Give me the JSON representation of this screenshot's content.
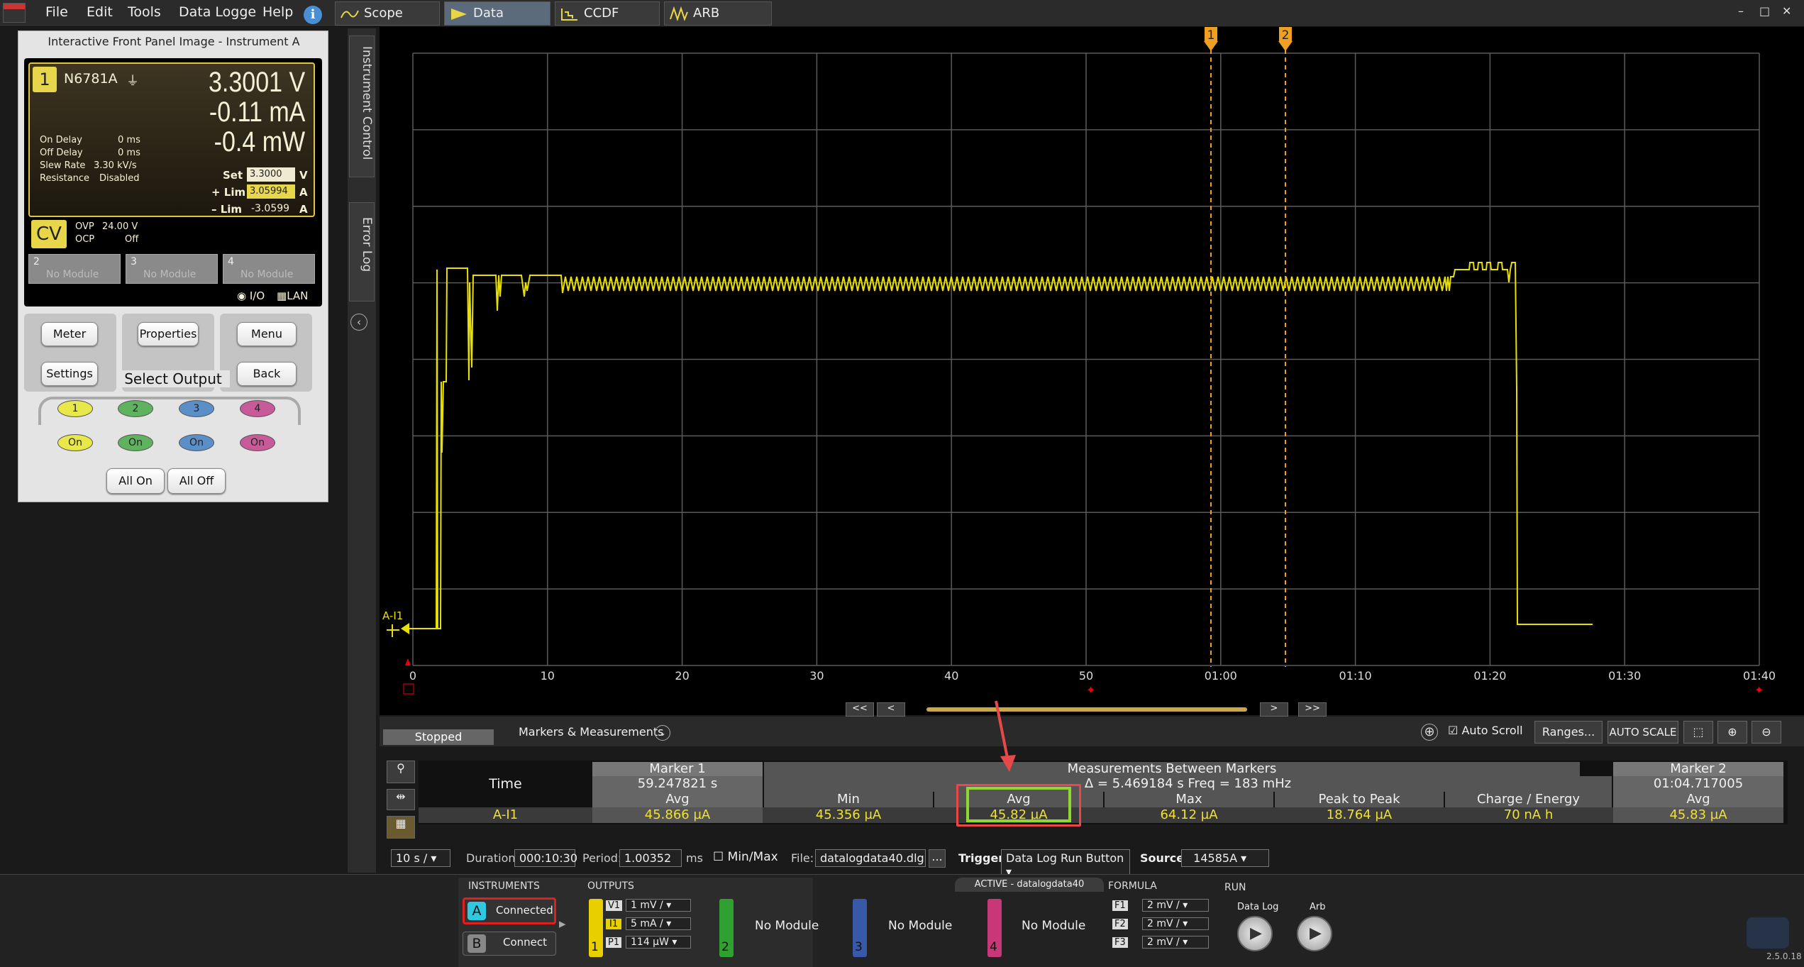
{
  "menubar": {
    "items": [
      "File",
      "Edit",
      "Tools",
      "Data Logge",
      "Help"
    ],
    "tabs": [
      "Scope",
      "Data Logger",
      "CCDF",
      "ARB"
    ],
    "window_controls": [
      "–",
      "□",
      "✕"
    ]
  },
  "front_panel": {
    "title": "Interactive Front Panel Image - Instrument A",
    "channel": "1",
    "model": "N6781A",
    "voltage": "3.3001 V",
    "current": "-0.11 mA",
    "power": "-0.4 mW",
    "on_delay_label": "On Delay",
    "on_delay_value": "0 ms",
    "off_delay_label": "Off Delay",
    "off_delay_value": "0 ms",
    "slew_label": "Slew Rate",
    "slew_value": "3.30 kV/s",
    "resistance_label": "Resistance",
    "resistance_value": "Disabled",
    "set_label": "Set",
    "set_value": "3.3000",
    "set_unit": "V",
    "plus_lim_label": "+ Lim",
    "plus_lim_value": "3.05994",
    "plus_lim_unit": "A",
    "minus_lim_label": "– Lim",
    "minus_lim_value": "-3.0599",
    "minus_lim_unit": "A",
    "mode": "CV",
    "ovp_label": "OVP",
    "ovp_value": "24.00 V",
    "ocp_label": "OCP",
    "ocp_value": "Off",
    "slots": [
      {
        "num": "2",
        "label": "No Module"
      },
      {
        "num": "3",
        "label": "No Module"
      },
      {
        "num": "4",
        "label": "No Module"
      }
    ],
    "io_label": "I/O",
    "lan_label": "LAN",
    "buttons": {
      "meter": "Meter",
      "settings": "Settings",
      "properties": "Properties",
      "menu": "Menu",
      "back": "Back"
    },
    "select_output": "Select Output",
    "outputs": [
      "1",
      "2",
      "3",
      "4"
    ],
    "on_label": "On",
    "all_on": "All On",
    "all_off": "All Off",
    "output_colors": [
      "#e8e84a",
      "#5fb35f",
      "#5a8fc7",
      "#c85a9a"
    ]
  },
  "side_tabs": {
    "instrument_control": "Instrument Control",
    "error_log": "Error Log"
  },
  "plot": {
    "trace_label": "A-I1",
    "marker1": "1",
    "marker2": "2",
    "x_ticks": [
      "0",
      "10",
      "20",
      "30",
      "40",
      "50",
      "01:00",
      "01:10",
      "01:20",
      "01:30",
      "01:40"
    ],
    "trace_color": "#e8e000"
  },
  "nav": {
    "first": "<<",
    "prev": "<",
    "next": ">",
    "last": ">>"
  },
  "controls": {
    "status": "Stopped",
    "markers_measurements": "Markers & Measurements",
    "auto_scroll": "Auto Scroll",
    "ranges": "Ranges...",
    "auto_scale": "AUTO SCALE"
  },
  "measurements": {
    "time_label": "Time",
    "marker1_header": "Marker 1",
    "marker1_time": "59.247821 s",
    "between_header": "Measurements Between Markers",
    "between_info": "Δ = 5.469184 s   Freq = 183 mHz",
    "marker2_header": "Marker 2",
    "marker2_time": "01:04.717005",
    "col_avg": "Avg",
    "col_min": "Min",
    "col_max": "Max",
    "col_ptp": "Peak to Peak",
    "col_charge": "Charge / Energy",
    "row_label": "A-I1",
    "m1_avg": "45.866 µA",
    "min": "45.356 µA",
    "avg": "45.82 µA",
    "max": "64.12 µA",
    "ptp": "18.764 µA",
    "charge": "70 nA h",
    "m2_avg": "45.83 µA"
  },
  "settings_bar": {
    "timebase": "10 s /",
    "duration_label": "Duration:",
    "duration_value": "000:10:30",
    "period_label": "Period:",
    "period_value": "1.00352",
    "period_unit": "ms",
    "minmax_label": "Min/Max",
    "file_label": "File:",
    "file_value": "datalogdata40.dlg",
    "browse": "...",
    "trigger_label": "Trigger",
    "trigger_value": "Data Log Run Button",
    "source_label": "Source",
    "source_value": "14585A"
  },
  "taskbar": {
    "instruments_label": "INSTRUMENTS",
    "inst_a": "A",
    "inst_a_status": "Connected",
    "inst_b": "B",
    "inst_b_status": "Connect",
    "outputs_label": "OUTPUTS",
    "v1_label": "V1",
    "v1_value": "1 mV /",
    "i1_label": "I1",
    "i1_value": "5 mA /",
    "p1_label": "P1",
    "p1_value": "114 µW",
    "channel_nums": [
      "1",
      "2",
      "3",
      "4"
    ],
    "no_module": "No Module",
    "active_label": "ACTIVE - datalogdata40",
    "formula_label": "FORMULA",
    "f1_label": "F1",
    "f1_value": "2 mV /",
    "f2_label": "F2",
    "f2_value": "2 mV /",
    "f3_label": "F3",
    "f3_value": "2 mV /",
    "run_label": "RUN",
    "data_log_label": "Data Log",
    "arb_label": "Arb",
    "version": "2.5.0.18"
  }
}
